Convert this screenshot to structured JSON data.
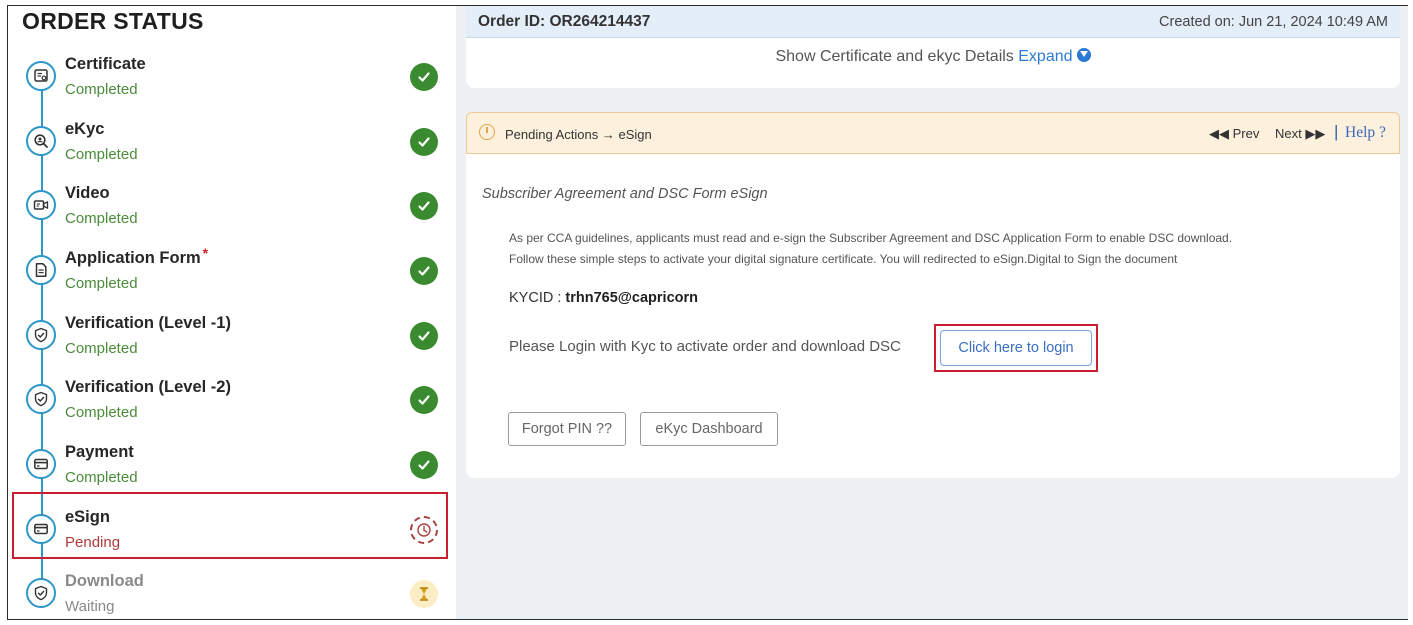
{
  "sidebar": {
    "title": "ORDER STATUS",
    "steps": [
      {
        "name": "Certificate",
        "status": "Completed",
        "icon": "certificate-icon",
        "state": "completed",
        "required_mark": ""
      },
      {
        "name": "eKyc",
        "status": "Completed",
        "icon": "search-user-icon",
        "state": "completed",
        "required_mark": ""
      },
      {
        "name": "Video",
        "status": "Completed",
        "icon": "video-icon",
        "state": "completed",
        "required_mark": ""
      },
      {
        "name": "Application Form",
        "status": "Completed",
        "icon": "document-icon",
        "state": "completed",
        "required_mark": "*"
      },
      {
        "name": "Verification (Level -1)",
        "status": "Completed",
        "icon": "shield-check-icon",
        "state": "completed",
        "required_mark": ""
      },
      {
        "name": "Verification (Level -2)",
        "status": "Completed",
        "icon": "shield-check-icon",
        "state": "completed",
        "required_mark": ""
      },
      {
        "name": "Payment",
        "status": "Completed",
        "icon": "card-icon",
        "state": "completed",
        "required_mark": ""
      },
      {
        "name": "eSign",
        "status": "Pending",
        "icon": "card-icon",
        "state": "pending",
        "required_mark": ""
      },
      {
        "name": "Download",
        "status": "Waiting",
        "icon": "shield-check-icon",
        "state": "waiting",
        "required_mark": ""
      }
    ]
  },
  "order": {
    "id_label": "Order ID: OR264214437",
    "created_on": "Created on: Jun 21, 2024 10:49 AM",
    "details_text": "Show Certificate and ekyc Details",
    "expand_label": "Expand"
  },
  "pending": {
    "label": "Pending Actions",
    "arrow": "→",
    "step": "eSign",
    "prev_label": "Prev",
    "next_label": "Next",
    "separator": "|",
    "help_label": "Help ?"
  },
  "agreement": {
    "title": "Subscriber Agreement and DSC Form eSign",
    "guideline_line1": "As per CCA guidelines, applicants must read and e-sign the Subscriber Agreement and DSC Application Form to enable DSC download.",
    "guideline_line2": "Follow these simple steps to activate your digital signature certificate. You will redirected to eSign.Digital to Sign the document",
    "kycid_label": "KYCID : ",
    "kycid_value": "trhn765@capricorn",
    "login_prompt": "Please Login with Kyc to activate order and download DSC",
    "login_button": "Click here to login",
    "forgot_pin_button": "Forgot PIN ??",
    "ekyc_dashboard_button": "eKyc Dashboard"
  },
  "colors": {
    "timeline": "#2d97c9",
    "completed": "#3a8a2f",
    "pending": "#b03a3a",
    "highlight": "#c8202f",
    "link": "#2b7bd6"
  }
}
